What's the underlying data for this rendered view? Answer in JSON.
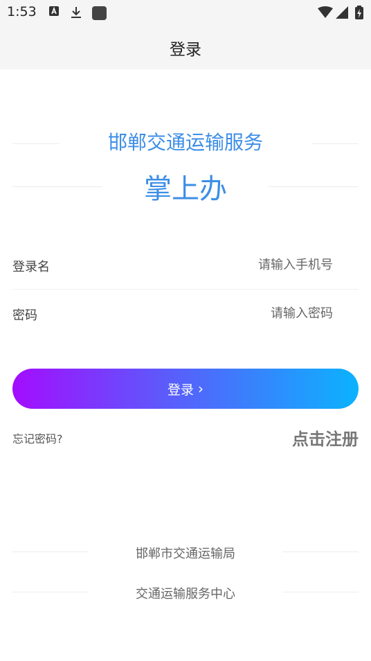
{
  "status_bar": {
    "time": "1:53"
  },
  "app_bar": {
    "title": "登录"
  },
  "brand": {
    "line1": "邯郸交通运输服务",
    "line2": "掌上办"
  },
  "form": {
    "username_label": "登录名",
    "username_placeholder": "请输入手机号",
    "password_label": "密码",
    "password_placeholder": "请输入密码"
  },
  "actions": {
    "login_label": "登录",
    "forgot_label": "忘记密码?",
    "register_label": "点击注册"
  },
  "footer": {
    "org1": "邯郸市交通运输局",
    "org2": "交通运输服务中心"
  },
  "colors": {
    "brand_blue": "#3d8ee6",
    "gradient_start": "#a30dfe",
    "gradient_end": "#0bb3fe"
  }
}
